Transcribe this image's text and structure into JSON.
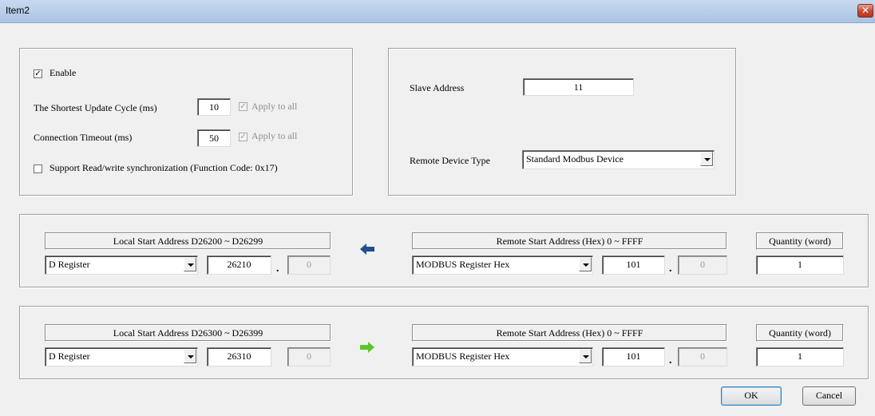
{
  "window": {
    "title": "Item2",
    "close_icon": "close-icon"
  },
  "general": {
    "enable_label": "Enable",
    "enable_checked": true,
    "update_cycle_label": "The Shortest Update Cycle (ms)",
    "update_cycle_value": "10",
    "apply_all_label_1": "Apply to all",
    "timeout_label": "Connection Timeout (ms)",
    "timeout_value": "50",
    "apply_all_label_2": "Apply to all",
    "sync_label": "Support Read/write synchronization (Function Code: 0x17)",
    "sync_checked": false
  },
  "slave": {
    "slave_address_label": "Slave Address",
    "slave_address_value": "11",
    "remote_type_label": "Remote Device Type",
    "remote_type_value": "Standard Modbus Device"
  },
  "mappings": [
    {
      "local_header": "Local Start Address D26200 ~ D26299",
      "local_type": "D Register",
      "local_address": "26210",
      "local_bit": "0",
      "direction": "read",
      "direction_color": "#1f4f8f",
      "remote_header": "Remote Start Address (Hex) 0 ~ FFFF",
      "remote_type": "MODBUS Register Hex",
      "remote_address": "101",
      "remote_bit": "0",
      "quantity_header": "Quantity (word)",
      "quantity_value": "1"
    },
    {
      "local_header": "Local Start Address D26300 ~ D26399",
      "local_type": "D Register",
      "local_address": "26310",
      "local_bit": "0",
      "direction": "write",
      "direction_color": "#5cc52c",
      "remote_header": "Remote Start Address (Hex) 0 ~ FFFF",
      "remote_type": "MODBUS Register Hex",
      "remote_address": "101",
      "remote_bit": "0",
      "quantity_header": "Quantity (word)",
      "quantity_value": "1"
    }
  ],
  "buttons": {
    "ok_label": "OK",
    "cancel_label": "Cancel"
  }
}
